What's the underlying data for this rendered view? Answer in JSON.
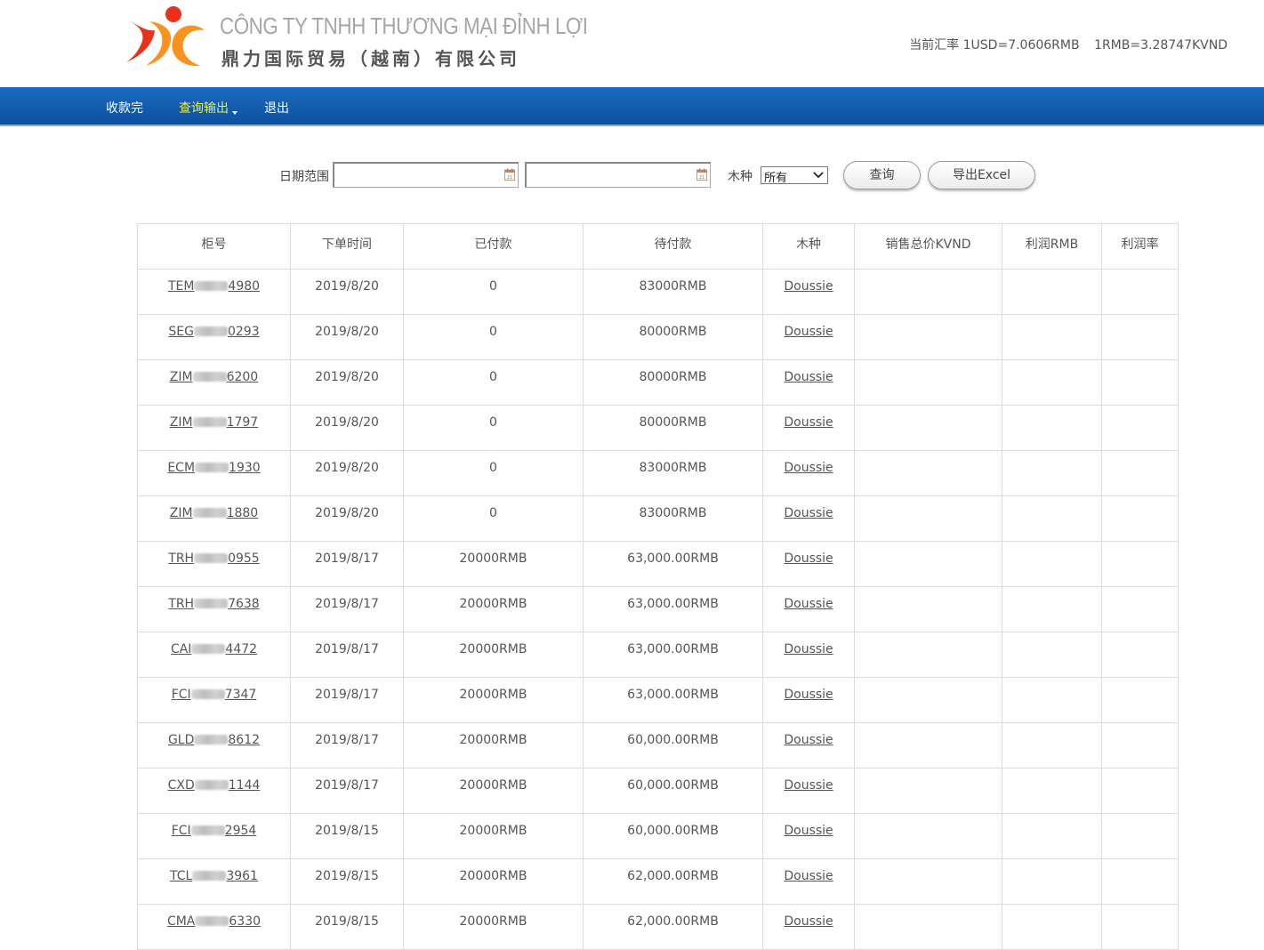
{
  "header": {
    "company_vn": "CÔNG TY TNHH THƯƠNG MẠI ĐỈNH LỢI",
    "company_cn": "鼎力国际贸易（越南）有限公司",
    "rate_usd": "当前汇率 1USD=7.0606RMB",
    "rate_rmb": "1RMB=3.28747KVND",
    "colors": {
      "logo_orange": "#f7931e",
      "logo_red": "#e8311b",
      "logo_text": "#a6a6a6"
    }
  },
  "nav": {
    "items": [
      {
        "label": "收款完"
      },
      {
        "label": "查询输出"
      },
      {
        "label": "退出"
      }
    ],
    "colors": {
      "bar": "#0d5aa7",
      "active_text": "#f1ee4a"
    }
  },
  "filter": {
    "date_label": "日期范围",
    "date_from": "",
    "date_to": "",
    "wood_label": "木种",
    "wood_selected": "所有",
    "query_button": "查询",
    "export_button": "导出Excel"
  },
  "table": {
    "columns": [
      "柜号",
      "下单时间",
      "已付款",
      "待付款",
      "木种",
      "销售总价KVND",
      "利润RMB",
      "利润率"
    ],
    "rows": [
      {
        "cabinet_prefix": "TEM",
        "cabinet_suffix": "4980",
        "date": "2019/8/20",
        "paid": "0",
        "pending": "83000RMB",
        "wood": "Doussie",
        "sales_kvnd": "",
        "profit": "",
        "margin": ""
      },
      {
        "cabinet_prefix": "SEG",
        "cabinet_suffix": "0293",
        "date": "2019/8/20",
        "paid": "0",
        "pending": "80000RMB",
        "wood": "Doussie",
        "sales_kvnd": "",
        "profit": "",
        "margin": ""
      },
      {
        "cabinet_prefix": "ZIM",
        "cabinet_suffix": "6200",
        "date": "2019/8/20",
        "paid": "0",
        "pending": "80000RMB",
        "wood": "Doussie",
        "sales_kvnd": "",
        "profit": "",
        "margin": ""
      },
      {
        "cabinet_prefix": "ZIM",
        "cabinet_suffix": "1797",
        "date": "2019/8/20",
        "paid": "0",
        "pending": "80000RMB",
        "wood": "Doussie",
        "sales_kvnd": "",
        "profit": "",
        "margin": ""
      },
      {
        "cabinet_prefix": "ECM",
        "cabinet_suffix": "1930",
        "date": "2019/8/20",
        "paid": "0",
        "pending": "83000RMB",
        "wood": "Doussie",
        "sales_kvnd": "",
        "profit": "",
        "margin": ""
      },
      {
        "cabinet_prefix": "ZIM",
        "cabinet_suffix": "1880",
        "date": "2019/8/20",
        "paid": "0",
        "pending": "83000RMB",
        "wood": "Doussie",
        "sales_kvnd": "",
        "profit": "",
        "margin": ""
      },
      {
        "cabinet_prefix": "TRH",
        "cabinet_suffix": "0955",
        "date": "2019/8/17",
        "paid": "20000RMB",
        "pending": "63,000.00RMB",
        "wood": "Doussie",
        "sales_kvnd": "",
        "profit": "",
        "margin": ""
      },
      {
        "cabinet_prefix": "TRH",
        "cabinet_suffix": "7638",
        "date": "2019/8/17",
        "paid": "20000RMB",
        "pending": "63,000.00RMB",
        "wood": "Doussie",
        "sales_kvnd": "",
        "profit": "",
        "margin": ""
      },
      {
        "cabinet_prefix": "CAI",
        "cabinet_suffix": "4472",
        "date": "2019/8/17",
        "paid": "20000RMB",
        "pending": "63,000.00RMB",
        "wood": "Doussie",
        "sales_kvnd": "",
        "profit": "",
        "margin": ""
      },
      {
        "cabinet_prefix": "FCI",
        "cabinet_suffix": "7347",
        "date": "2019/8/17",
        "paid": "20000RMB",
        "pending": "63,000.00RMB",
        "wood": "Doussie",
        "sales_kvnd": "",
        "profit": "",
        "margin": ""
      },
      {
        "cabinet_prefix": "GLD",
        "cabinet_suffix": "8612",
        "date": "2019/8/17",
        "paid": "20000RMB",
        "pending": "60,000.00RMB",
        "wood": "Doussie",
        "sales_kvnd": "",
        "profit": "",
        "margin": ""
      },
      {
        "cabinet_prefix": "CXD",
        "cabinet_suffix": "1144",
        "date": "2019/8/17",
        "paid": "20000RMB",
        "pending": "60,000.00RMB",
        "wood": "Doussie",
        "sales_kvnd": "",
        "profit": "",
        "margin": ""
      },
      {
        "cabinet_prefix": "FCI",
        "cabinet_suffix": "2954",
        "date": "2019/8/15",
        "paid": "20000RMB",
        "pending": "60,000.00RMB",
        "wood": "Doussie",
        "sales_kvnd": "",
        "profit": "",
        "margin": ""
      },
      {
        "cabinet_prefix": "TCL",
        "cabinet_suffix": "3961",
        "date": "2019/8/15",
        "paid": "20000RMB",
        "pending": "62,000.00RMB",
        "wood": "Doussie",
        "sales_kvnd": "",
        "profit": "",
        "margin": ""
      },
      {
        "cabinet_prefix": "CMA",
        "cabinet_suffix": "6330",
        "date": "2019/8/15",
        "paid": "20000RMB",
        "pending": "62,000.00RMB",
        "wood": "Doussie",
        "sales_kvnd": "",
        "profit": "",
        "margin": ""
      }
    ]
  }
}
